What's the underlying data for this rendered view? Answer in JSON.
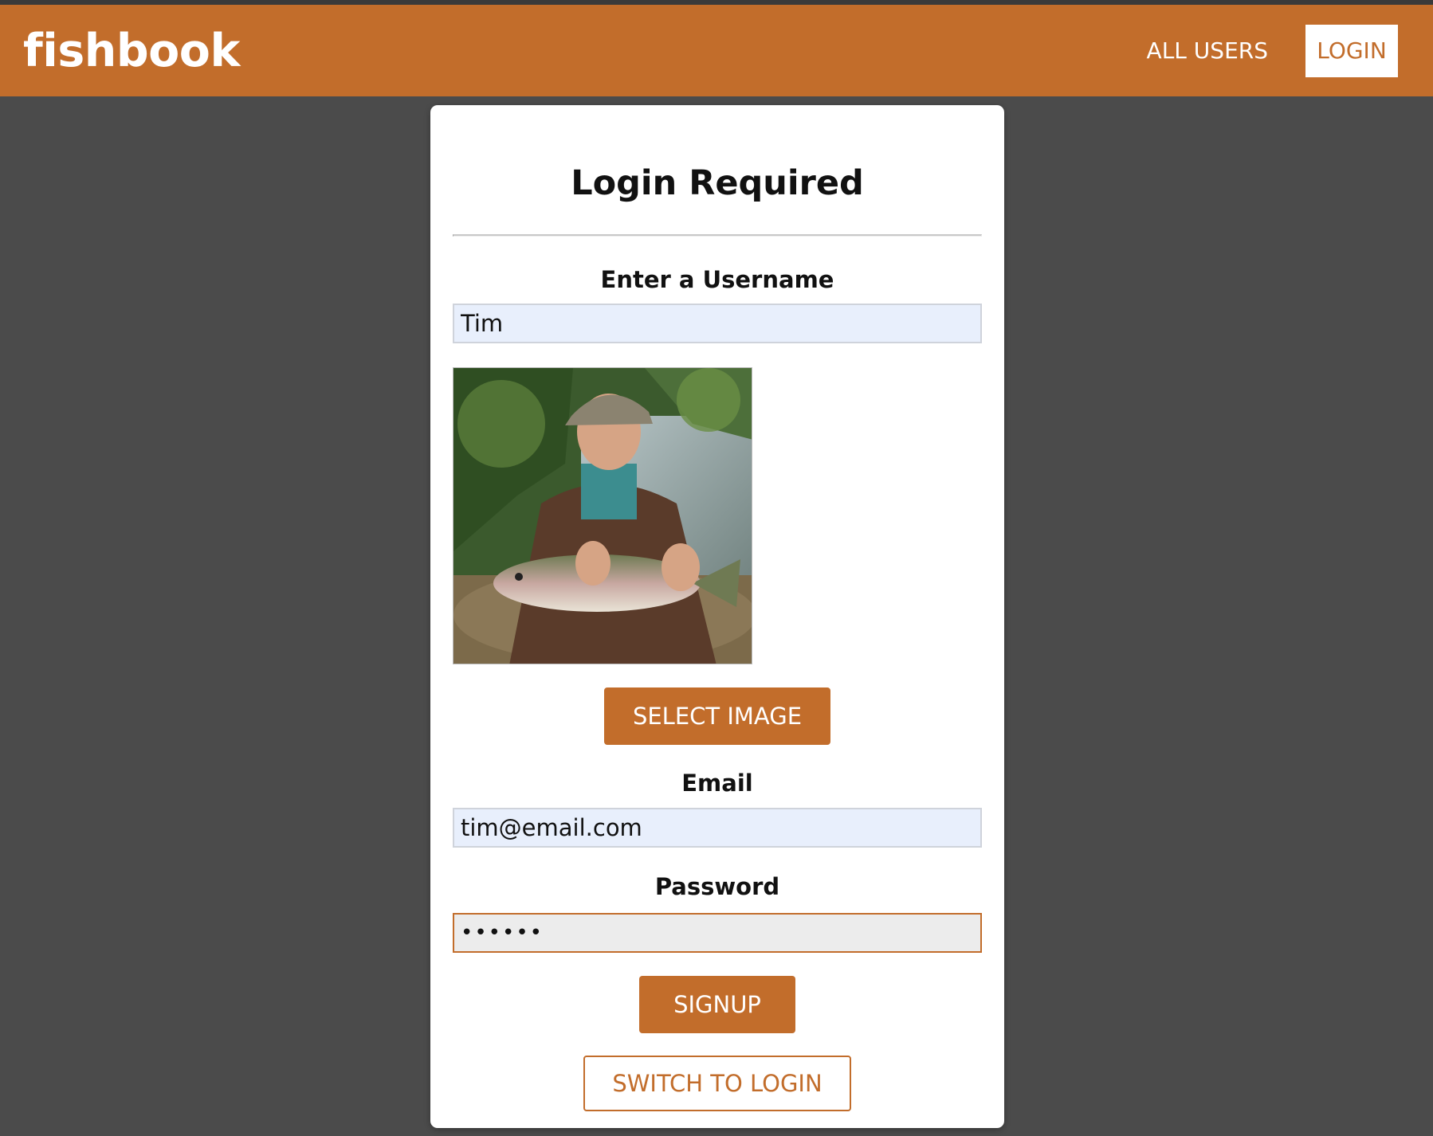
{
  "header": {
    "logo": "fishbook",
    "nav": {
      "all_users": "ALL USERS",
      "login": "LOGIN"
    }
  },
  "auth_card": {
    "title": "Login Required",
    "username": {
      "label": "Enter a Username",
      "value": "Tim"
    },
    "image_button": "SELECT IMAGE",
    "email": {
      "label": "Email",
      "value": "tim@email.com"
    },
    "password": {
      "label": "Password",
      "value": "••••••"
    },
    "submit_button": "SIGNUP",
    "switch_button": "SWITCH TO LOGIN"
  },
  "colors": {
    "accent": "#c26d2b",
    "background": "#4b4b4b",
    "card": "#ffffff",
    "autofill_input": "#e8effc"
  }
}
